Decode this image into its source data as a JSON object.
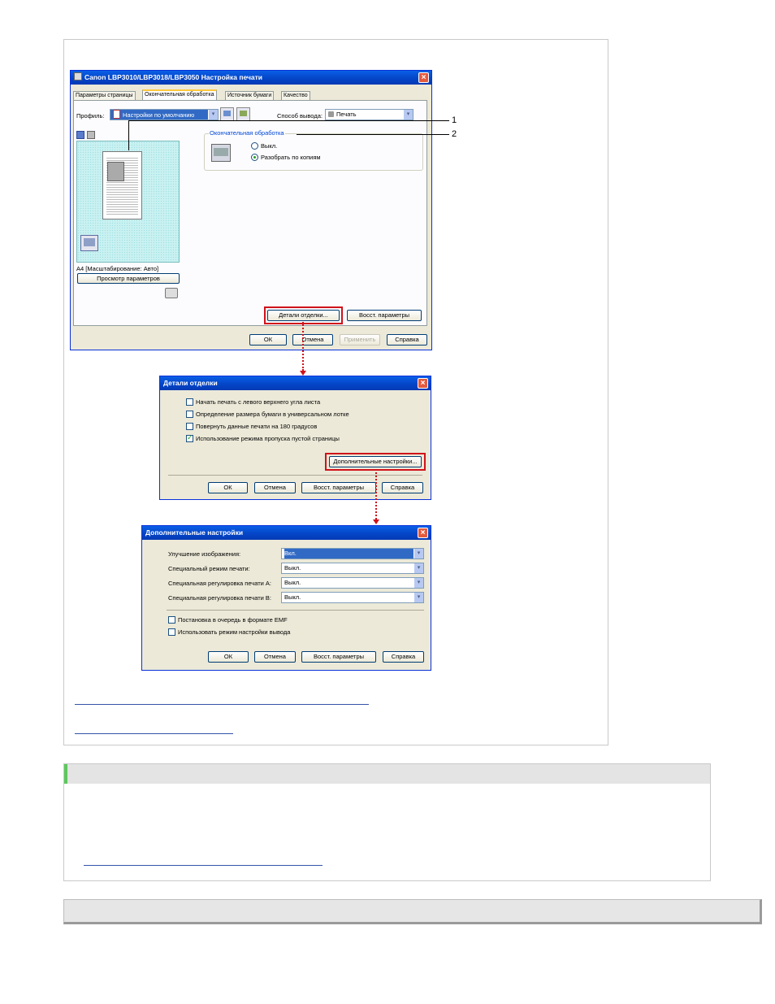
{
  "print_dialog": {
    "title": "Canon LBP3010/LBP3018/LBP3050 Настройка печати",
    "tabs": [
      "Параметры страницы",
      "Окончательная обработка",
      "Источник бумаги",
      "Качество"
    ],
    "profile_label": "Профиль:",
    "profile_value": "Настройки по умолчанию",
    "output_method_label": "Способ вывода:",
    "output_method_value": "Печать",
    "finishing_group": "Окончательная обработка",
    "radio_off": "Выкл.",
    "radio_collate": "Разобрать по копиям",
    "preview_caption": "A4 [Масштабирование: Авто]",
    "view_settings_button": "Просмотр параметров",
    "finishing_details_button": "Детали отделки...",
    "restore_button": "Восст. параметры",
    "ok": "ОК",
    "cancel": "Отмена",
    "apply": "Применить",
    "help": "Справка",
    "callout_1": "1",
    "callout_2": "2"
  },
  "finishing_details": {
    "title": "Детали отделки",
    "options": [
      {
        "label": "Начать печать с левого верхнего угла листа",
        "checked": false
      },
      {
        "label": "Определение размера бумаги в универсальном лотке",
        "checked": false
      },
      {
        "label": "Повернуть данные печати на 180 градусов",
        "checked": false
      },
      {
        "label": "Использование режима пропуска пустой страницы",
        "checked": true
      }
    ],
    "advanced_button": "Дополнительные настройки...",
    "ok": "ОК",
    "cancel": "Отмена",
    "restore": "Восст. параметры",
    "help": "Справка"
  },
  "advanced_settings": {
    "title": "Дополнительные настройки",
    "rows": [
      {
        "label": "Улучшение изображения:",
        "value": "Вкл."
      },
      {
        "label": "Специальный режим печати:",
        "value": "Выкл."
      },
      {
        "label": "Специальная регулировка печати A:",
        "value": "Выкл."
      },
      {
        "label": "Специальная регулировка печати B:",
        "value": "Выкл."
      }
    ],
    "checks": [
      {
        "label": "Постановка в очередь в формате EMF",
        "checked": false
      },
      {
        "label": "Использовать режим настройки вывода",
        "checked": false
      }
    ],
    "ok": "ОК",
    "cancel": "Отмена",
    "restore": "Восст. параметры",
    "help": "Справка"
  },
  "colors": {
    "titlebar": "#0446c8",
    "highlight": "#d0121b",
    "preview_bg": "#c9f1f2",
    "green_accent": "#5cc85c"
  }
}
